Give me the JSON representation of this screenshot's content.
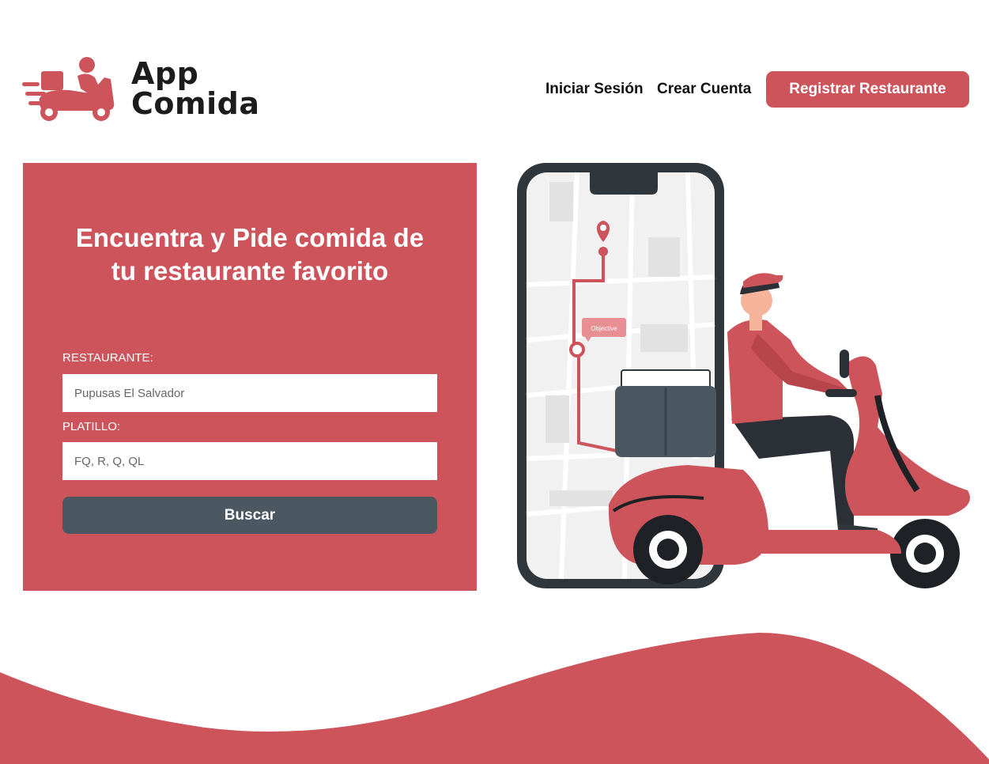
{
  "brand": {
    "line1": "App",
    "line2": "Comida",
    "logo_icon": "delivery-scooter-icon",
    "accent_color": "#cd545b"
  },
  "nav": {
    "login": "Iniciar Sesión",
    "signup": "Crear Cuenta",
    "register_restaurant": "Registrar Restaurante"
  },
  "hero": {
    "title_line1": "Encuentra y Pide comida de",
    "title_line2": "tu restaurante favorito"
  },
  "search": {
    "restaurant_label": "RESTAURANTE:",
    "restaurant_placeholder": "Pupusas El Salvador",
    "dish_label": "PLATILLO:",
    "dish_placeholder": "FQ, R, Q, QL",
    "button_label": "Buscar",
    "button_color": "#4b5862"
  },
  "illustration": {
    "map_bubble": "Objective",
    "phone_icon": "phone-map-icon",
    "rider_icon": "delivery-rider-icon"
  }
}
